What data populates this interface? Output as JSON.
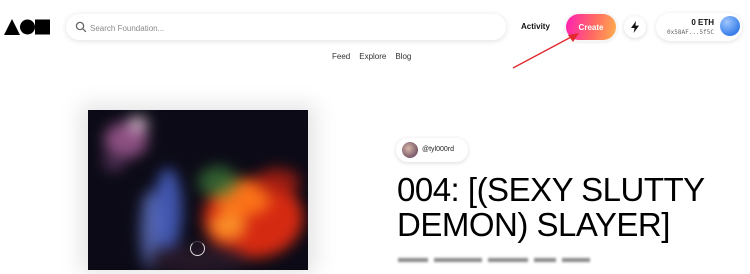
{
  "header": {
    "logo_name": "foundation-logo",
    "search": {
      "placeholder": "Search Foundation..."
    },
    "activity_label": "Activity",
    "create_label": "Create",
    "wallet": {
      "balance": "0 ETH",
      "address": "0x58AF...5f5C"
    }
  },
  "nav": {
    "items": [
      "Feed",
      "Explore",
      "Blog"
    ]
  },
  "artwork": {
    "loading": true
  },
  "creator": {
    "handle": "@tyl000rd"
  },
  "artwork_title": {
    "line1": "004: [(SEXY SLUTTY",
    "line2": "DEMON) SLAYER]"
  },
  "colors": {
    "create_gradient": [
      "#ff1fb5",
      "#ff6a63",
      "#ffb04d"
    ],
    "annotation_arrow": "#e0282e",
    "wallet_avatar": "#3a7fe8"
  }
}
